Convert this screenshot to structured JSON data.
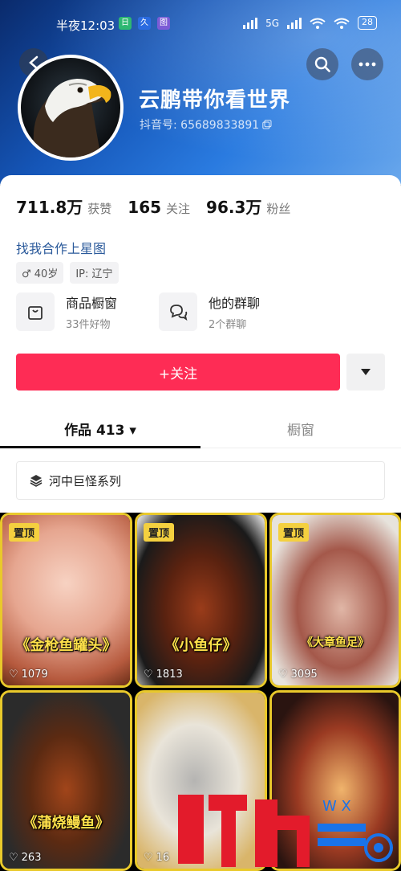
{
  "status_bar": {
    "time": "半夜12:03",
    "badges": [
      {
        "text": "日",
        "color": "#2eb872"
      },
      {
        "text": "久",
        "color": "#2b6be0"
      },
      {
        "text": "图",
        "color": "#7b5cd6"
      }
    ],
    "network": "5G",
    "battery": "28"
  },
  "profile": {
    "name": "云鹏带你看世界",
    "douyin_id": "抖音号: 65689833891",
    "stats": [
      {
        "value": "711.8万",
        "label": "获赞"
      },
      {
        "value": "165",
        "label": "关注"
      },
      {
        "value": "96.3万",
        "label": "粉丝"
      }
    ],
    "partner_link": "找我合作上星图",
    "tags": {
      "gender_age": "♂ 40岁",
      "ip": "IP: 辽宁"
    },
    "entries": [
      {
        "title": "商品橱窗",
        "subtitle": "33件好物",
        "icon": "shop-window-icon"
      },
      {
        "title": "他的群聊",
        "subtitle": "2个群聊",
        "icon": "group-chat-icon"
      }
    ],
    "follow_label": "+关注",
    "tabs": [
      {
        "label": "作品 413 ▾",
        "active": true
      },
      {
        "label": "橱窗",
        "active": false
      }
    ],
    "collection_label": "河中巨怪系列"
  },
  "videos": [
    {
      "pin": "置顶",
      "caption": "《金枪鱼罐头》",
      "likes": "1079",
      "colors": [
        "#d98a6a",
        "#f1c7b6"
      ]
    },
    {
      "pin": "置顶",
      "caption": "《小鱼仔》",
      "likes": "1813",
      "colors": [
        "#3b2a22",
        "#8c3b1f"
      ]
    },
    {
      "pin": "置顶",
      "caption": "《大章鱼足》",
      "likes": "3095",
      "colors": [
        "#d7b9a9",
        "#7a3b30"
      ]
    },
    {
      "pin": "",
      "caption": "《蒲烧鳗鱼》",
      "likes": "263",
      "colors": [
        "#2a2a2a",
        "#7b3410"
      ]
    },
    {
      "pin": "",
      "caption": "",
      "likes": "16",
      "colors": [
        "#e6e0d4",
        "#b7b6b4"
      ]
    },
    {
      "pin": "",
      "caption": "",
      "likes": "",
      "colors": [
        "#3a1c18",
        "#e39b58"
      ]
    }
  ],
  "watermark_text": "W X"
}
